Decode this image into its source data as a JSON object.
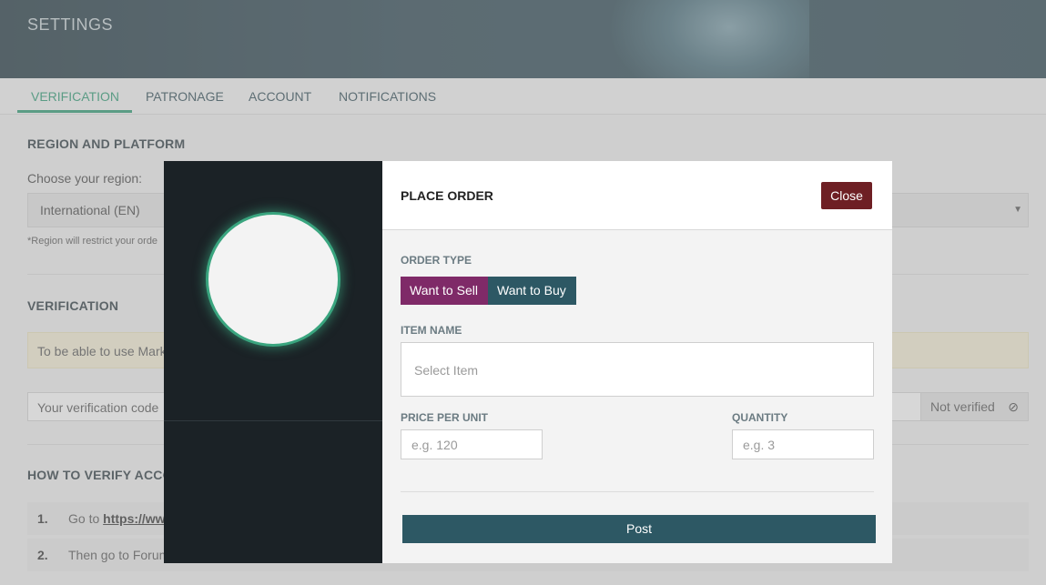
{
  "header": {
    "title": "SETTINGS"
  },
  "tabs": [
    {
      "label": "VERIFICATION",
      "active": true
    },
    {
      "label": "PATRONAGE",
      "active": false
    },
    {
      "label": "ACCOUNT",
      "active": false
    },
    {
      "label": "NOTIFICATIONS",
      "active": false
    }
  ],
  "region": {
    "heading": "REGION AND PLATFORM",
    "choose_label": "Choose your region:",
    "selected": "International (EN)",
    "note": "*Region will restrict your orde"
  },
  "verification": {
    "heading": "VERIFICATION",
    "warning_text": "To be able to use Marke",
    "code_placeholder": "Your verification code",
    "status": "Not verified"
  },
  "how_to": {
    "heading": "HOW TO VERIFY ACCO",
    "steps": [
      {
        "num": "1.",
        "prefix": "Go to ",
        "link": "https://www"
      },
      {
        "num": "2.",
        "prefix": "Then go to Forum",
        "link": ""
      }
    ]
  },
  "modal": {
    "title": "PLACE ORDER",
    "close_label": "Close",
    "order_type_label": "ORDER TYPE",
    "sell_label": "Want to Sell",
    "buy_label": "Want to Buy",
    "item_name_label": "ITEM NAME",
    "item_placeholder": "Select Item",
    "price_label": "PRICE PER UNIT",
    "price_placeholder": "e.g. 120",
    "quantity_label": "QUANTITY",
    "quantity_placeholder": "e.g. 3",
    "post_label": "Post"
  },
  "colors": {
    "accent": "#2a9a72",
    "sell": "#7f2a68",
    "buy": "#2d5864",
    "close": "#6e1f24",
    "modal_side": "#1b2226"
  }
}
